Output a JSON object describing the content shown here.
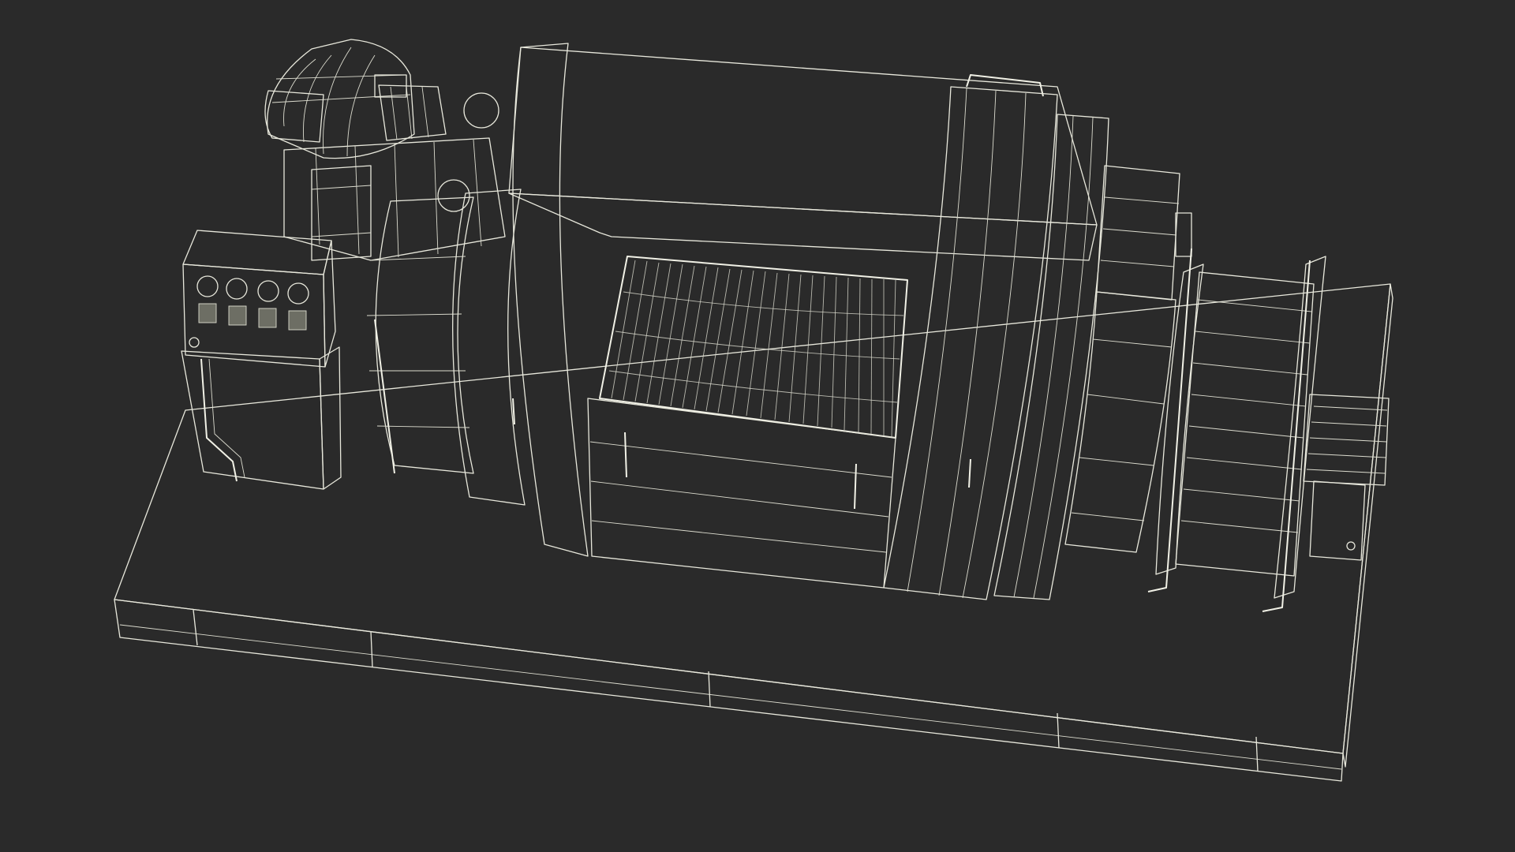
{
  "scene": {
    "background_color": "#2a2a2a",
    "surface_light": "#7a7b70",
    "surface_mid": "#6c6d63",
    "surface_dark": "#5d5e55",
    "wire_color": "#e8e8dc",
    "control_panel": {
      "gauge_count": 4,
      "switch_count": 4
    }
  }
}
